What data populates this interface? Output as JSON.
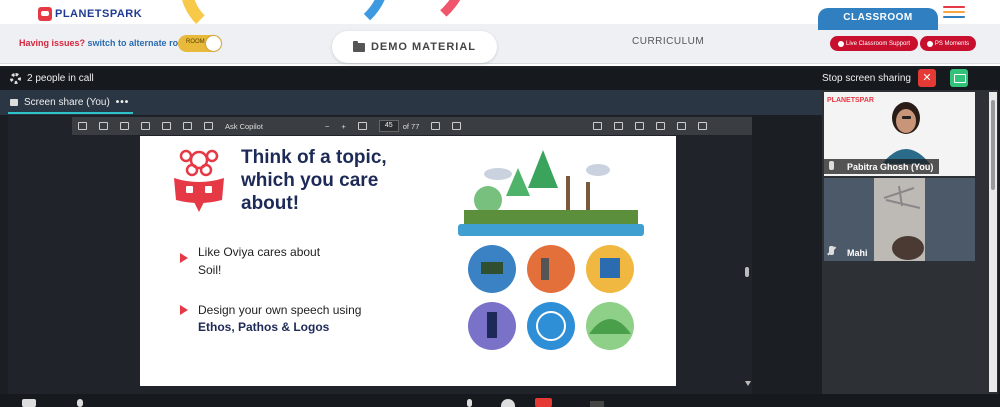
{
  "header": {
    "logo_text": "PLANETSPARK",
    "issues_text": "Having issues?",
    "alternate_room_link": "switch to alternate room",
    "room_toggle_label": "ROOM",
    "demo_material_label": "DEMO MATERIAL",
    "curriculum_label": "CURRICULUM",
    "classroom_tab": "CLASSROOM",
    "live_support_label": "Live Classroom Support",
    "ps_moments_label": "PS Moments",
    "menu_colors": [
      "#e63946",
      "#f7a541",
      "#2f7fc1",
      "#33c27a"
    ]
  },
  "call": {
    "people_count_text": "2 people in call",
    "stop_share_label": "Stop screen sharing",
    "stop_share_x": "✕",
    "share_tab_label": "Screen share (You)",
    "share_tab_more": "•••"
  },
  "pdf_toolbar": {
    "ask_copilot": "Ask Copilot",
    "zoom_out": "−",
    "zoom_in": "+",
    "page_current": "45",
    "page_total": "of 77"
  },
  "slide": {
    "title": "Think of a topic, which you care about!",
    "bullet1_line1": "Like Oviya cares about",
    "bullet1_line2": "Soil!",
    "bullet2_line1": "Design your own speech using",
    "bullet2_line2": "Ethos, Pathos & Logos"
  },
  "participants": [
    {
      "name": "Pabitra Ghosh (You)",
      "tile_logo": "PLANETSPARK"
    },
    {
      "name": "Mahi"
    }
  ],
  "colors": {
    "accent_red": "#c8102e",
    "classroom_blue": "#2f7fc1",
    "share_green": "#33c27a",
    "slide_title": "#1d2a57"
  }
}
